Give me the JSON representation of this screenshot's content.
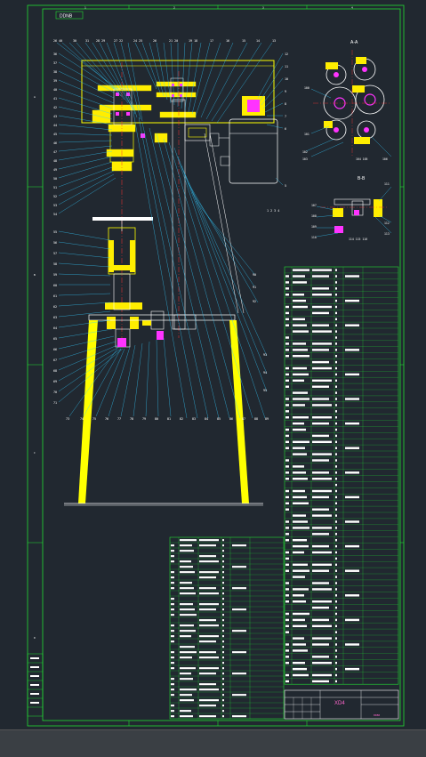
{
  "drawing": {
    "title_tag": "DDNB",
    "frame_color": "#22dd33",
    "border_zone_numbers": [
      "1",
      "2",
      "3",
      "4"
    ],
    "border_zone_letters": [
      "A",
      "B",
      "C",
      "D",
      "E"
    ],
    "colors": {
      "background": "#212830",
      "frame": "#22dd33",
      "outline": "#ffff00",
      "leaders": "#33ccff",
      "magenta": "#ff33ff",
      "centerline": "#ff3333",
      "white": "#ffffff"
    },
    "title_block": {
      "name": "XD4",
      "drawing_no": "8080"
    },
    "section_label": "A-A",
    "small_section_label": "B-B"
  },
  "statusbar": {}
}
